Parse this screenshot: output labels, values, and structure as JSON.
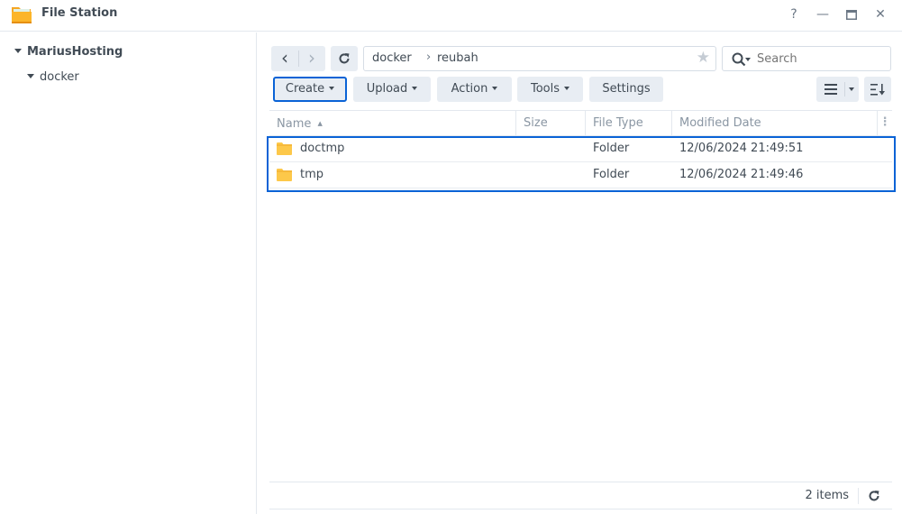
{
  "window": {
    "title": "File Station",
    "controls": {
      "help": "?",
      "minimize": "—",
      "maximize": "▭",
      "close": "✕"
    }
  },
  "sidebar": {
    "root": "MariusHosting",
    "items": [
      {
        "label": "docker"
      }
    ]
  },
  "toolbar": {
    "back_icon": "‹",
    "forward_icon": "›",
    "refresh_icon": "↻",
    "path": [
      "docker",
      "reubah"
    ],
    "path_separator": "›",
    "favorite_icon": "★",
    "search_placeholder": "Search",
    "create_label": "Create",
    "upload_label": "Upload",
    "action_label": "Action",
    "tools_label": "Tools",
    "settings_label": "Settings"
  },
  "grid": {
    "columns": [
      "Name",
      "Size",
      "File Type",
      "Modified Date"
    ],
    "sort_indicator": "▲",
    "rows": [
      {
        "name": "doctmp",
        "size": "",
        "type": "Folder",
        "modified": "12/06/2024 21:49:51"
      },
      {
        "name": "tmp",
        "size": "",
        "type": "Folder",
        "modified": "12/06/2024 21:49:46"
      }
    ]
  },
  "footer": {
    "item_count": "2 items"
  },
  "colors": {
    "accent": "#0a63d6",
    "folder": "#fdc84a",
    "button_bg": "#e8edf3"
  }
}
